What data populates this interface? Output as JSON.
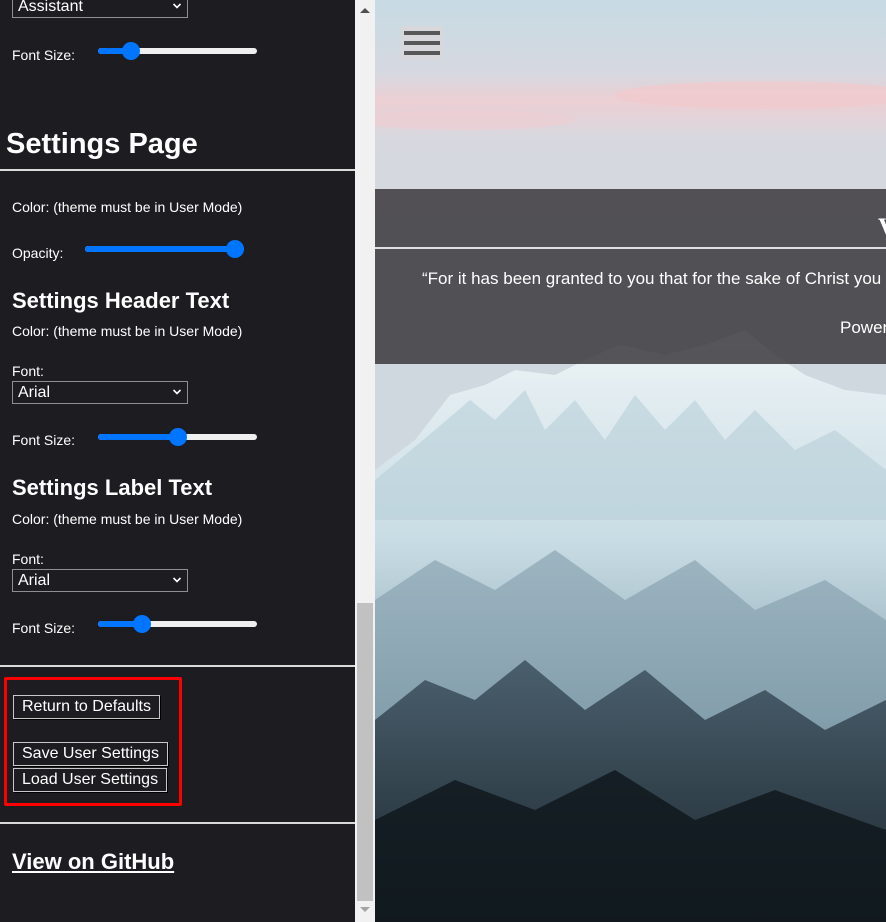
{
  "sidebar": {
    "top_font_select": {
      "value": "Assistant"
    },
    "top_font_size": {
      "label": "Font Size:",
      "value": 0.17
    },
    "settings_page": {
      "heading": "Settings Page",
      "color_label": "Color: (theme must be in User Mode)",
      "opacity_label": "Opacity:",
      "opacity_value": 1.0
    },
    "header_text": {
      "heading": "Settings Header Text",
      "color_label": "Color: (theme must be in User Mode)",
      "font_label": "Font:",
      "font_value": "Arial",
      "font_size_label": "Font Size:",
      "font_size_value": 0.5
    },
    "label_text": {
      "heading": "Settings Label Text",
      "color_label": "Color: (theme must be in User Mode)",
      "font_label": "Font:",
      "font_value": "Arial",
      "font_size_label": "Font Size:",
      "font_size_value": 0.25
    },
    "buttons": {
      "return_defaults": "Return to Defaults",
      "save_settings": "Save User Settings",
      "load_settings": "Load User Settings"
    },
    "github_link": "View on GitHub"
  },
  "main": {
    "menu_icon": "hamburger-menu-icon",
    "quote_title": "V",
    "quote_text": "“For it has been granted to you that for the sake of Christ you",
    "powered_by": "Power"
  },
  "colors": {
    "sidebar_bg": "#1d1c21",
    "accent": "#0075ff",
    "highlight": "#ff0000"
  }
}
